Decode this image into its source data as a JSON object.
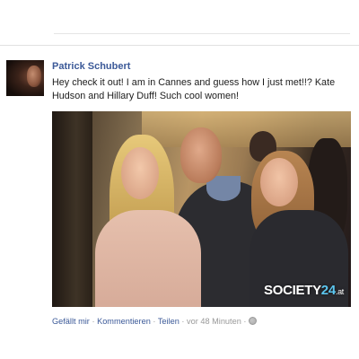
{
  "post": {
    "author": "Patrick Schubert",
    "message": "Hey check it out! I am in Cannes and guess how I just met!!? Kate Hudson and Hillary Duff! Such cool women!",
    "photo": {
      "watermark_prefix": "SOCIETY",
      "watermark_number": "24",
      "watermark_tld": ".at"
    }
  },
  "actions": {
    "like": "Gefällt mir",
    "comment": "Kommentieren",
    "share": "Teilen",
    "separator": "·",
    "timestamp": "vor 48 Minuten",
    "privacy_icon": "globe-icon"
  }
}
